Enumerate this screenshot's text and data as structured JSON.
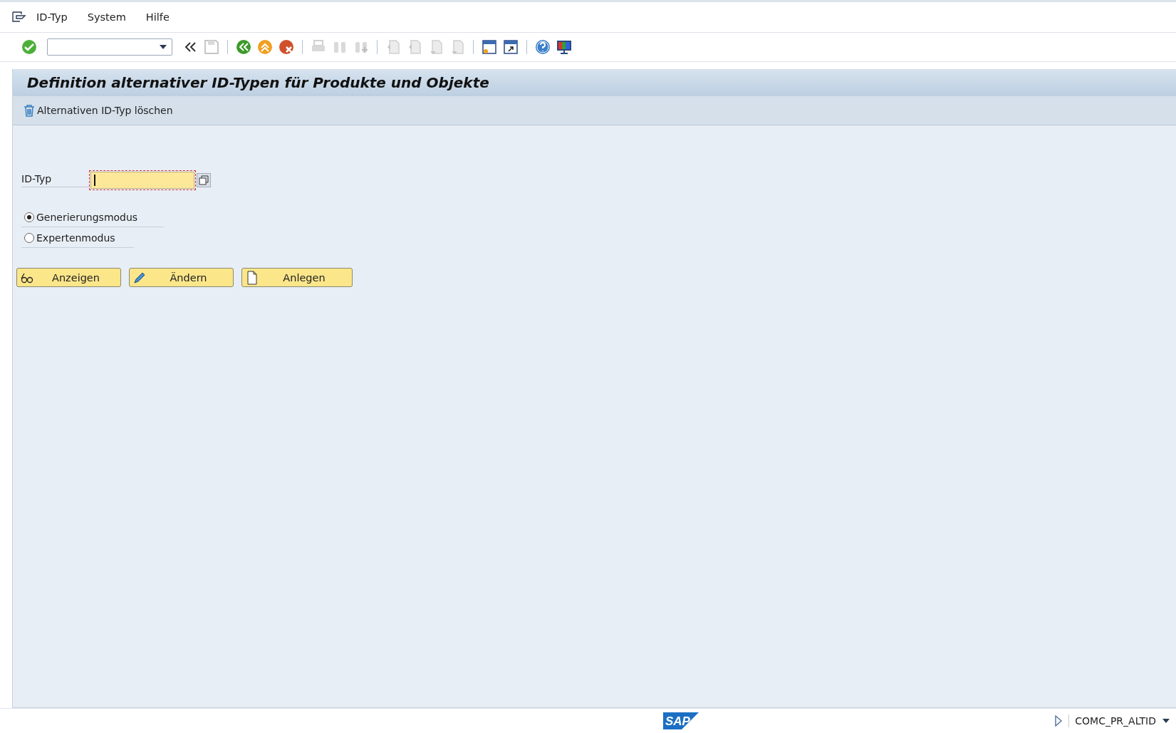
{
  "menu": [
    {
      "label": "ID-Typ"
    },
    {
      "label": "System"
    },
    {
      "label": "Hilfe"
    }
  ],
  "toolbar": [
    {
      "kind": "check",
      "disabled": false
    },
    {
      "kind": "command-field"
    },
    {
      "kind": "chevrons",
      "disabled": false
    },
    {
      "kind": "save",
      "disabled": true
    },
    {
      "kind": "sep"
    },
    {
      "kind": "back",
      "disabled": false
    },
    {
      "kind": "exit",
      "disabled": false
    },
    {
      "kind": "cancel",
      "disabled": false
    },
    {
      "kind": "sep"
    },
    {
      "kind": "print",
      "disabled": true
    },
    {
      "kind": "find",
      "disabled": true
    },
    {
      "kind": "find-next",
      "disabled": true
    },
    {
      "kind": "sep"
    },
    {
      "kind": "first-page",
      "disabled": true
    },
    {
      "kind": "prev-page",
      "disabled": true
    },
    {
      "kind": "next-page",
      "disabled": true
    },
    {
      "kind": "last-page",
      "disabled": true
    },
    {
      "kind": "sep"
    },
    {
      "kind": "new-session",
      "disabled": false
    },
    {
      "kind": "shortcut",
      "disabled": false
    },
    {
      "kind": "sep"
    },
    {
      "kind": "help",
      "disabled": false
    },
    {
      "kind": "layout",
      "disabled": false
    }
  ],
  "title": "Definition alternativer ID-Typen für Produkte und Objekte",
  "app_toolbar": [
    {
      "label": "Alternativen ID-Typ löschen"
    }
  ],
  "field": {
    "label": "ID-Typ"
  },
  "radios": [
    {
      "label": "Generierungsmodus",
      "selected": true
    },
    {
      "label": "Expertenmodus",
      "selected": false
    }
  ],
  "buttons": [
    {
      "kind": "display",
      "label": "Anzeigen"
    },
    {
      "kind": "change",
      "label": "Ändern"
    },
    {
      "kind": "create",
      "label": "Anlegen"
    }
  ],
  "status_bar": {
    "logo": "SAP",
    "transaction": "COMC_PR_ALTID"
  }
}
